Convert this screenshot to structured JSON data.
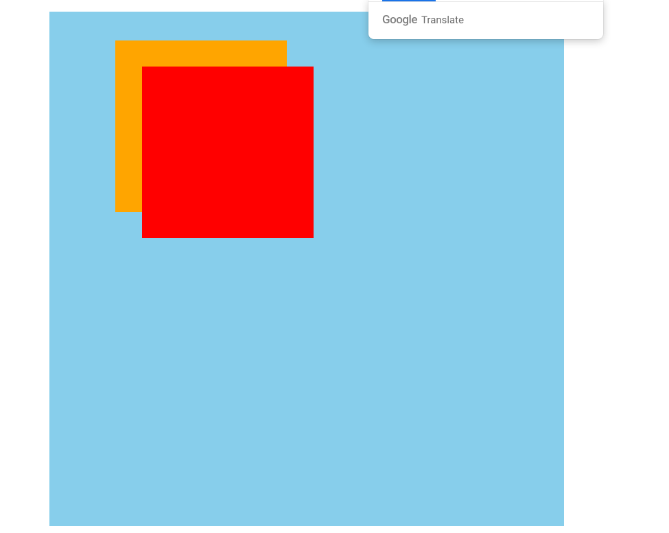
{
  "canvas": {
    "background_color": "#87ceeb",
    "shapes": [
      {
        "name": "orange-square",
        "color": "#ffa500"
      },
      {
        "name": "red-square",
        "color": "#ff0000"
      }
    ]
  },
  "translate_popup": {
    "logo": {
      "letters": [
        "G",
        "o",
        "o",
        "g",
        "l",
        "e"
      ],
      "text": "Google"
    },
    "label": "Translate",
    "tabs": {
      "active_index": 0
    }
  }
}
